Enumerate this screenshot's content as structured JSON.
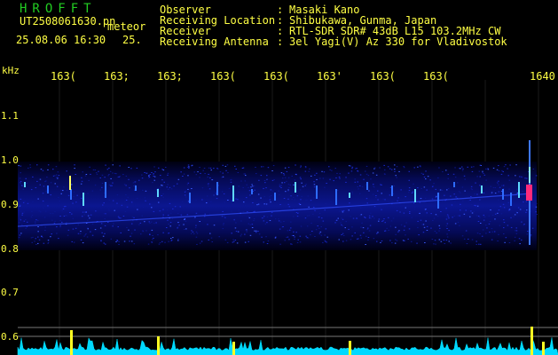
{
  "brand": "HROFFT",
  "file_label": "UT2508061630.pn",
  "kind_label": "meteor",
  "datetime": "25.08.06 16:30",
  "count": "25.",
  "header": [
    {
      "label": "Observer",
      "value": "Masaki Kano"
    },
    {
      "label": "Receiving Location",
      "value": "Shibukawa, Gunma, Japan"
    },
    {
      "label": "Receiver",
      "value": "RTL-SDR SDR# 43dB L15 103.2MHz CW"
    },
    {
      "label": "Receiving Antenna",
      "value": "3el Yagi(V) Az 330 for Vladivostok"
    }
  ],
  "colon": ":",
  "y_axis": {
    "unit": "kHz",
    "ticks": [
      "1.1",
      "1.0",
      "0.9",
      "0.8",
      "0.7",
      "0.6"
    ]
  },
  "x_axis": {
    "ticks": [
      "163(",
      "163;",
      "163;",
      "163(",
      "163(",
      "163'",
      "163(",
      "163(",
      "1640"
    ]
  },
  "colors": {
    "text": "#ffff44",
    "brand": "#22cc22",
    "trace": "#00e0ff",
    "background": "#000000"
  }
}
